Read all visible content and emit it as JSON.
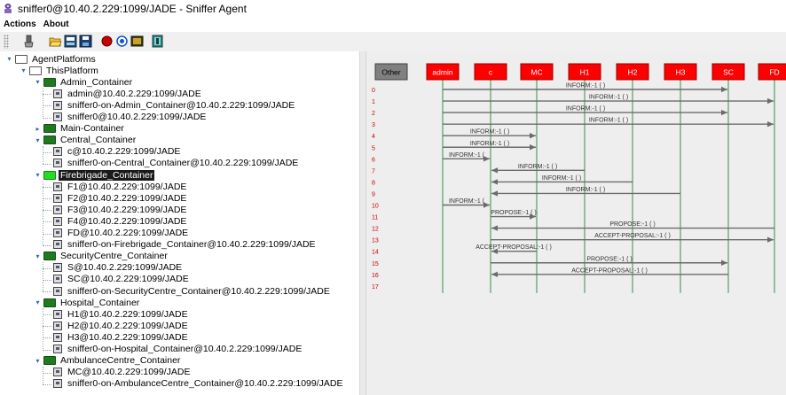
{
  "window": {
    "title": "sniffer0@10.40.2.229:1099/JADE - Sniffer Agent"
  },
  "menu": [
    {
      "label": "Actions"
    },
    {
      "label": "About"
    }
  ],
  "toolbar": [
    {
      "icon": "clear-canvas-icon"
    },
    {
      "icon": "open-folder-icon"
    },
    {
      "icon": "display-log-icon"
    },
    {
      "icon": "save-icon"
    },
    {
      "icon": "record-icon"
    },
    {
      "icon": "sniff-on-icon"
    },
    {
      "icon": "filter-icon"
    },
    {
      "icon": "exit-door-icon"
    }
  ],
  "tree": [
    {
      "label": "AgentPlatforms",
      "kind": "folder",
      "level": 0,
      "expanded": true
    },
    {
      "label": "ThisPlatform",
      "kind": "folder",
      "level": 1,
      "expanded": true
    },
    {
      "label": "Admin_Container",
      "kind": "container",
      "level": 2,
      "expanded": true
    },
    {
      "label": "admin@10.40.2.229:1099/JADE",
      "kind": "agent",
      "level": 3
    },
    {
      "label": "sniffer0-on-Admin_Container@10.40.2.229:1099/JADE",
      "kind": "agent",
      "level": 3
    },
    {
      "label": "sniffer0@10.40.2.229:1099/JADE",
      "kind": "agent",
      "level": 3
    },
    {
      "label": "Main-Container",
      "kind": "container",
      "level": 2,
      "expanded": false
    },
    {
      "label": "Central_Container",
      "kind": "container",
      "level": 2,
      "expanded": true
    },
    {
      "label": "c@10.40.2.229:1099/JADE",
      "kind": "agent",
      "level": 3
    },
    {
      "label": "sniffer0-on-Central_Container@10.40.2.229:1099/JADE",
      "kind": "agent",
      "level": 3
    },
    {
      "label": "Firebrigade_Container",
      "kind": "container",
      "level": 2,
      "expanded": true,
      "selected": true
    },
    {
      "label": "F1@10.40.2.229:1099/JADE",
      "kind": "agent",
      "level": 3
    },
    {
      "label": "F2@10.40.2.229:1099/JADE",
      "kind": "agent",
      "level": 3
    },
    {
      "label": "F3@10.40.2.229:1099/JADE",
      "kind": "agent",
      "level": 3
    },
    {
      "label": "F4@10.40.2.229:1099/JADE",
      "kind": "agent",
      "level": 3
    },
    {
      "label": "FD@10.40.2.229:1099/JADE",
      "kind": "agent",
      "level": 3
    },
    {
      "label": "sniffer0-on-Firebrigade_Container@10.40.2.229:1099/JADE",
      "kind": "agent",
      "level": 3
    },
    {
      "label": "SecurityCentre_Container",
      "kind": "container",
      "level": 2,
      "expanded": true
    },
    {
      "label": "S@10.40.2.229:1099/JADE",
      "kind": "agent",
      "level": 3
    },
    {
      "label": "SC@10.40.2.229:1099/JADE",
      "kind": "agent",
      "level": 3
    },
    {
      "label": "sniffer0-on-SecurityCentre_Container@10.40.2.229:1099/JADE",
      "kind": "agent",
      "level": 3
    },
    {
      "label": "Hospital_Container",
      "kind": "container",
      "level": 2,
      "expanded": true
    },
    {
      "label": "H1@10.40.2.229:1099/JADE",
      "kind": "agent",
      "level": 3
    },
    {
      "label": "H2@10.40.2.229:1099/JADE",
      "kind": "agent",
      "level": 3
    },
    {
      "label": "H3@10.40.2.229:1099/JADE",
      "kind": "agent",
      "level": 3
    },
    {
      "label": "sniffer0-on-Hospital_Container@10.40.2.229:1099/JADE",
      "kind": "agent",
      "level": 3
    },
    {
      "label": "AmbulanceCentre_Container",
      "kind": "container",
      "level": 2,
      "expanded": true
    },
    {
      "label": "MC@10.40.2.229:1099/JADE",
      "kind": "agent",
      "level": 3
    },
    {
      "label": "sniffer0-on-AmbulanceCentre_Container@10.40.2.229:1099/JADE",
      "kind": "agent",
      "level": 3
    }
  ],
  "sniffer": {
    "colors": {
      "other": "#808080",
      "agent": "#ff0000",
      "agent_text": "#ffffff",
      "lifeline": "#3b8c4a",
      "arrow": "#6b6b6b",
      "row_number": "#cc0000"
    },
    "agents": [
      {
        "name": "Other",
        "other": true
      },
      {
        "name": "admin"
      },
      {
        "name": "c"
      },
      {
        "name": "MC"
      },
      {
        "name": "H1"
      },
      {
        "name": "H2"
      },
      {
        "name": "H3"
      },
      {
        "name": "SC"
      },
      {
        "name": "FD"
      }
    ],
    "messages": [
      {
        "row": "0",
        "from": "admin",
        "to": "SC",
        "label": "INFORM:-1 (     )"
      },
      {
        "row": "1",
        "from": "admin",
        "to": "FD",
        "label": "INFORM:-1 (     )"
      },
      {
        "row": "2",
        "from": "admin",
        "to": "SC",
        "label": "INFORM:-1 (     )"
      },
      {
        "row": "3",
        "from": "admin",
        "to": "FD",
        "label": "INFORM:-1 (     )"
      },
      {
        "row": "4",
        "from": "admin",
        "to": "MC",
        "label": "INFORM:-1 (     )"
      },
      {
        "row": "5",
        "from": "admin",
        "to": "MC",
        "label": "INFORM:-1 (     )"
      },
      {
        "row": "6",
        "from": "admin",
        "to": "c",
        "label": "INFORM:-1 ("
      },
      {
        "row": "7",
        "from": "H1",
        "to": "c",
        "label": "INFORM:-1 (     )"
      },
      {
        "row": "8",
        "from": "H2",
        "to": "c",
        "label": "INFORM:-1 (     )"
      },
      {
        "row": "9",
        "from": "H3",
        "to": "c",
        "label": "INFORM:-1 (     )"
      },
      {
        "row": "10",
        "from": "admin",
        "to": "c",
        "label": "INFORM:-1 ("
      },
      {
        "row": "11",
        "from": "c",
        "to": "MC",
        "label": "PROPOSE:-1 (     )"
      },
      {
        "row": "12",
        "from": "FD",
        "to": "c",
        "label": "PROPOSE:-1 (     )"
      },
      {
        "row": "13",
        "from": "c",
        "to": "FD",
        "label": "ACCEPT-PROPOSAL:-1 (     )"
      },
      {
        "row": "14",
        "from": "MC",
        "to": "c",
        "label": "ACCEPT-PROPOSAL:-1 (     )"
      },
      {
        "row": "15",
        "from": "c",
        "to": "SC",
        "label": "PROPOSE:-1 (     )"
      },
      {
        "row": "16",
        "from": "SC",
        "to": "c",
        "label": "ACCEPT-PROPOSAL:-1 (     )"
      },
      {
        "row": "17",
        "from": null,
        "to": null,
        "label": ""
      }
    ]
  }
}
